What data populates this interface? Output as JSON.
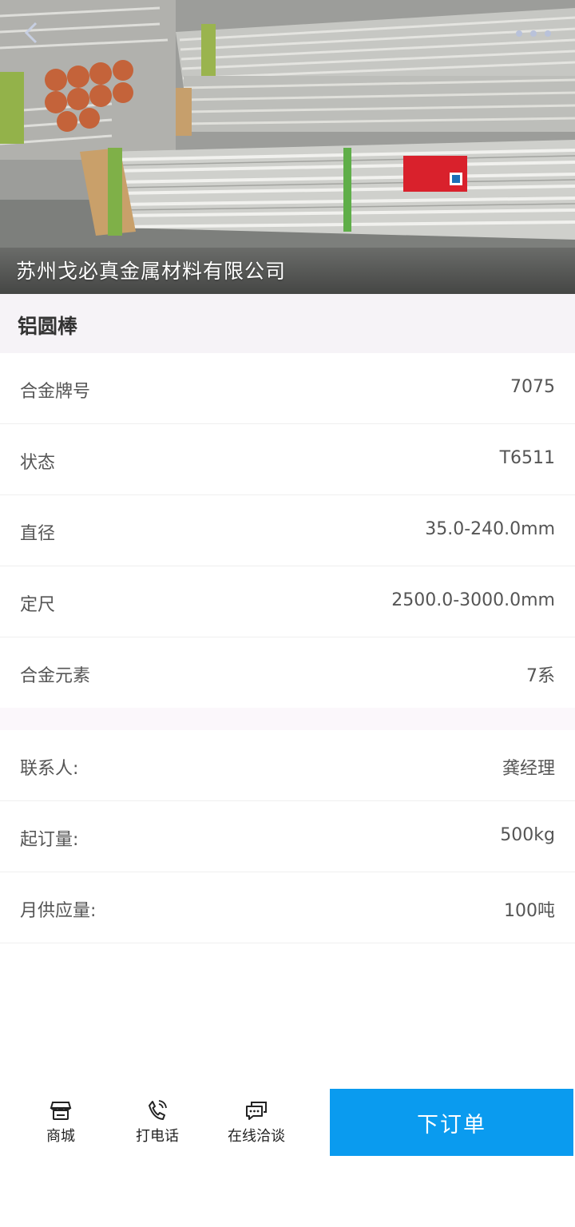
{
  "hero": {
    "company_name": "苏州戈必真金属材料有限公司",
    "back_icon": "chevron-left-icon",
    "more_icon": "more-dots-icon"
  },
  "product": {
    "title": "铝圆棒"
  },
  "specs": [
    {
      "label": "合金牌号",
      "value": "7075"
    },
    {
      "label": "状态",
      "value": "T6511"
    },
    {
      "label": "直径",
      "value": "35.0-240.0mm"
    },
    {
      "label": "定尺",
      "value": "2500.0-3000.0mm"
    },
    {
      "label": "合金元素",
      "value": "7系"
    }
  ],
  "contact": [
    {
      "label": "联系人:",
      "value": "龚经理"
    },
    {
      "label": "起订量:",
      "value": "500kg"
    },
    {
      "label": "月供应量:",
      "value": "100吨"
    }
  ],
  "bottom_bar": {
    "shop": {
      "label": "商城",
      "icon": "store-icon"
    },
    "call": {
      "label": "打电话",
      "icon": "phone-icon"
    },
    "chat": {
      "label": "在线洽谈",
      "icon": "chat-icon"
    },
    "order_label": "下订单"
  },
  "colors": {
    "accent": "#0a9bef",
    "title_bg": "#f6f3f7"
  }
}
